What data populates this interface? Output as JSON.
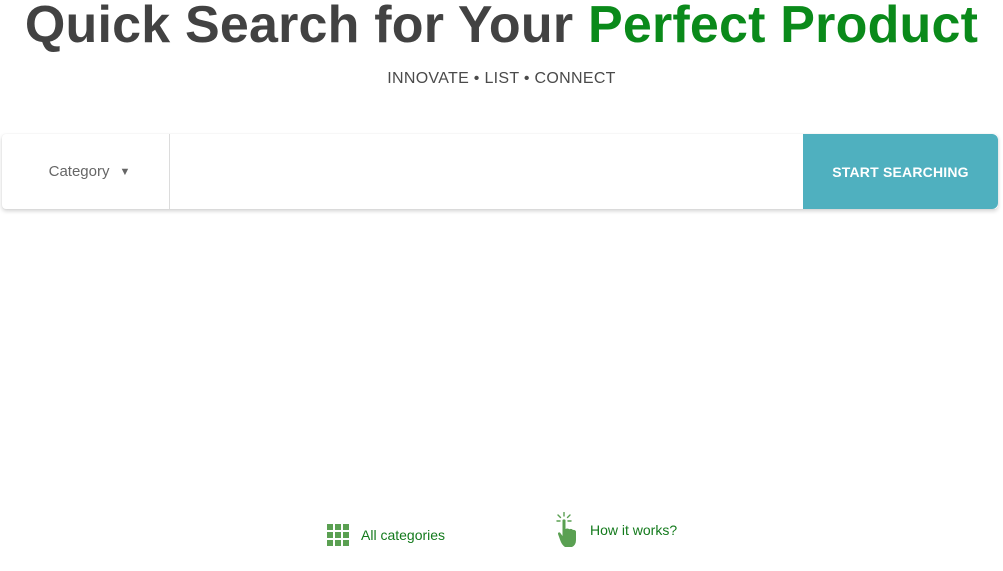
{
  "hero": {
    "title_main": "Quick Search for Your ",
    "title_accent": "Perfect Product",
    "tagline": "INNOVATE • LIST • CONNECT"
  },
  "search": {
    "category_label": "Category",
    "input_value": "",
    "input_placeholder": "",
    "button_label": "START SEARCHING"
  },
  "links": {
    "all_categories": "All categories",
    "how_it_works": "How it works?"
  },
  "colors": {
    "accent_green": "#0a8a1a",
    "button_teal": "#4fb0bf",
    "link_green": "#137a1c",
    "icon_green": "#5aa052",
    "title_gray": "#424242"
  },
  "icons": {
    "category_chevron": "chevron-down-icon",
    "all_categories": "grid-icon",
    "how_it_works": "pointing-hand-icon"
  }
}
